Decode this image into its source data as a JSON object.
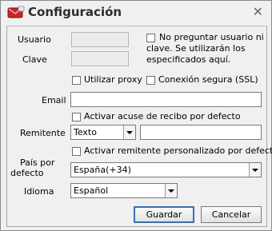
{
  "window": {
    "title": "Configuración",
    "close_glyph": "✕"
  },
  "fields": {
    "usuario_label": "Usuario",
    "usuario_value": "",
    "clave_label": "Clave",
    "clave_value": "",
    "no_preguntar_label_line1": "No preguntar usuario ni",
    "no_preguntar_label_line2": "clave. Se utilizarán los",
    "no_preguntar_label_line3": "especificados aquí.",
    "no_preguntar_checked": false,
    "utilizar_proxy_label": "Utilizar proxy",
    "utilizar_proxy_checked": false,
    "conexion_segura_label": "Conexión segura (SSL)",
    "conexion_segura_checked": false,
    "email_label": "Email",
    "email_value": "",
    "acuse_label": "Activar acuse de recibo por defecto",
    "acuse_checked": false,
    "remitente_label": "Remitente",
    "remitente_type_value": "Texto",
    "remitente_value": "",
    "activar_remitente_label": "Activar remitente personalizado por defecto",
    "activar_remitente_checked": false,
    "pais_label_line1": "País por",
    "pais_label_line2": "defecto",
    "pais_value": "España(+34)",
    "idioma_label": "Idioma",
    "idioma_value": "Español"
  },
  "buttons": {
    "guardar": "Guardar",
    "cancelar": "Cancelar"
  },
  "icons": {
    "app": "red-envelope-icon",
    "close": "close-icon",
    "dropdown": "chevron-down-icon"
  }
}
